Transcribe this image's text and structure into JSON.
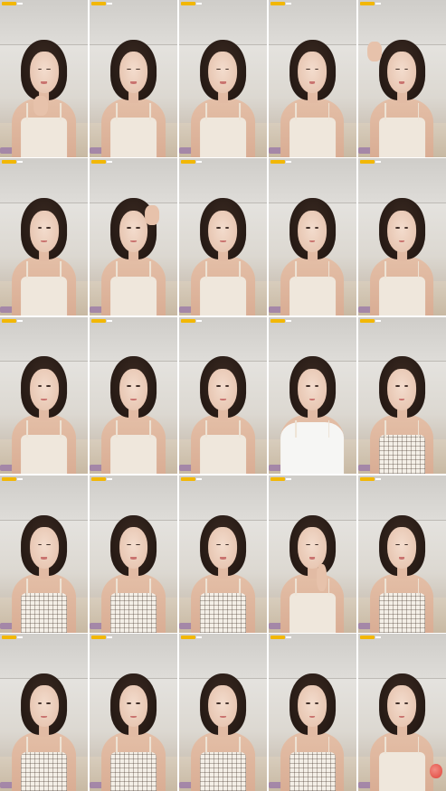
{
  "frames": [
    {
      "variant": "chin"
    },
    {
      "variant": "plain"
    },
    {
      "variant": "plain"
    },
    {
      "variant": "plain"
    },
    {
      "variant": "wave"
    },
    {
      "variant": "plain"
    },
    {
      "variant": "head"
    },
    {
      "variant": "plain"
    },
    {
      "variant": "plain"
    },
    {
      "variant": "plain"
    },
    {
      "variant": "plain"
    },
    {
      "variant": "plain"
    },
    {
      "variant": "plain"
    },
    {
      "variant": "white"
    },
    {
      "variant": "plaid"
    },
    {
      "variant": "plaid"
    },
    {
      "variant": "plaid"
    },
    {
      "variant": "plaid"
    },
    {
      "variant": "peace"
    },
    {
      "variant": "plaid"
    },
    {
      "variant": "plaid"
    },
    {
      "variant": "plaid"
    },
    {
      "variant": "plaid"
    },
    {
      "variant": "plaid"
    },
    {
      "variant": "ball"
    }
  ],
  "colors": {
    "badge": "#f2b705",
    "wall": "#e4e2de",
    "hair": "#2a1d17",
    "mat": "#9a79a8"
  }
}
